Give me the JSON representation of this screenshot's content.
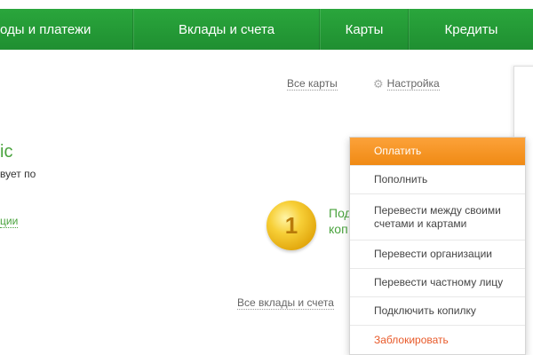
{
  "nav": {
    "tabs": [
      {
        "label": "оды и платежи"
      },
      {
        "label": "Вклады и счета"
      },
      {
        "label": "Карты"
      },
      {
        "label": "Кредиты"
      }
    ]
  },
  "links": {
    "all_cards": "Все карты",
    "settings": "Настройка",
    "all_deposits": "Все вклады и счета"
  },
  "card": {
    "title_fragment": "ic",
    "text_fragment": "вует по",
    "link_fragment": "ции"
  },
  "promo": {
    "line1": "Под",
    "line2": "коп"
  },
  "coin": {
    "value": "1"
  },
  "dropdown": {
    "items": [
      {
        "label": "Оплатить"
      },
      {
        "label": "Пополнить"
      },
      {
        "label": "Перевести между своими счетами и картами"
      },
      {
        "label": "Перевести организации"
      },
      {
        "label": "Перевести частному лицу"
      },
      {
        "label": "Подключить копилку"
      },
      {
        "label": "Заблокировать"
      }
    ]
  },
  "colors": {
    "nav_green": "#2aa63c",
    "accent_green": "#4aa33e",
    "menu_orange": "#f59320",
    "danger": "#e85a2a"
  }
}
